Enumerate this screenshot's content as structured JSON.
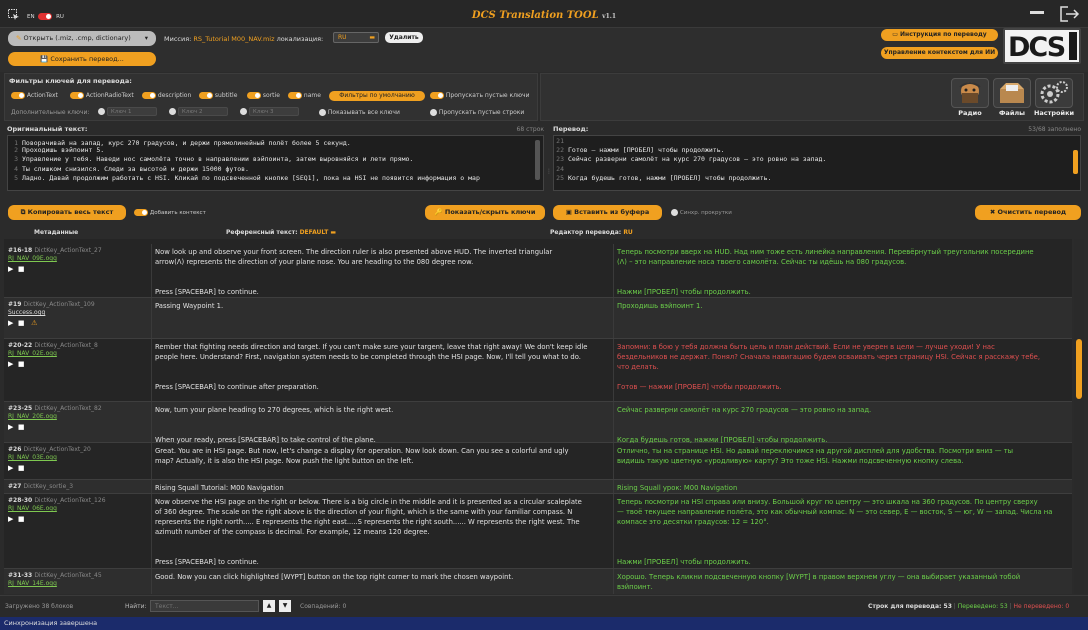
{
  "app": {
    "title": "DCS Translation TOOL",
    "version": "v1.1"
  },
  "lang": {
    "en": "EN",
    "ru": "RU"
  },
  "toolbar": {
    "open_label": "Открыть (.miz, .cmp, dictionary)",
    "save_label": "Сохранить перевод...",
    "mission_label": "Миссия:",
    "mission_value": "RS_Tutorial M00_NAV.miz",
    "locale_label": "локализация:",
    "locale_value": "RU",
    "delete_label": "Удалить",
    "instructions_label": "Инструкция по переводу",
    "context_label": "Управление контекстом для ИИ"
  },
  "filters": {
    "title": "Фильтры ключей для перевода:",
    "items": [
      "ActionText",
      "ActionRadioText",
      "description",
      "subtitle",
      "sortie",
      "name"
    ],
    "default_button": "Фильтры по умолчанию",
    "skip_empty": "Пропускать пустые ключи",
    "extra_label": "Дополнительные ключи:",
    "key_placeholders": [
      "Ключ 1",
      "Ключ 2",
      "Ключ 3"
    ],
    "show_all": "Показывать все ключи",
    "skip_empty_lines": "Пропускать пустые строки"
  },
  "side_buttons": [
    {
      "label": "Радио",
      "icon": "radio-icon"
    },
    {
      "label": "Файлы",
      "icon": "files-icon"
    },
    {
      "label": "Настройки",
      "icon": "gear-icon"
    }
  ],
  "original": {
    "label": "Оригинальный текст:",
    "count": "68 строк",
    "lines": [
      {
        "n": "1",
        "t": "Поворачивай на запад, курс 270 градусов, и держи прямолинейный полёт более 5 секунд."
      },
      {
        "n": "2",
        "t": "Проходишь вэйпоинт 5."
      },
      {
        "n": "3",
        "t": "Управление у тебя. Наведи нос самолёта точно в направлении вэйпоинта, затем выровняйся и лети прямо."
      },
      {
        "n": "4",
        "t": "Ты слишком снизился. Следи за высотой и держи 15000 футов."
      },
      {
        "n": "5",
        "t": "Ладно. Давай продолжим работать с HSI. Кликай по подсвеченной кнопке [SEQ1], пока на HSI не появится информация о мар"
      }
    ],
    "copy_all": "Копировать весь текст",
    "add_context": "Добавить контекст"
  },
  "translation": {
    "label": "Перевод:",
    "count": "53/68 заполнено",
    "lines": [
      {
        "n": "21",
        "t": ""
      },
      {
        "n": "22",
        "t": "Готов — нажми [ПРОБЕЛ] чтобы продолжить."
      },
      {
        "n": "23",
        "t": "Сейчас разверни самолёт на курс 270 градусов — это ровно на запад."
      },
      {
        "n": "24",
        "t": ""
      },
      {
        "n": "25",
        "t": "Когда будешь готов, нажми [ПРОБЕЛ] чтобы продолжить."
      }
    ],
    "paste": "Вставить из буфера",
    "sync_scroll": "Синхр. прокрутки",
    "clear": "Очистить перевод"
  },
  "mid": {
    "toggle_keys": "Показать/скрыть ключи",
    "meta_label": "Метаданные",
    "ref_label": "Референсный текст:",
    "ref_value": "DEFAULT",
    "editor_label": "Редактор перевода:",
    "editor_value": "RU"
  },
  "rows": [
    {
      "id": "#16-18",
      "key": "DictKey_ActionText_27",
      "file": "RJ_NAV_09E.ogg",
      "warn": false,
      "en": "Now look up and observe your front screen. The direction ruler is also presented above HUD. The inverted triangular\narrow(Λ) represents the direction of your plane nose. You are heading to the 080 degree now.\n\n\nPress [SPACEBAR] to continue.",
      "ru": "Теперь посмотри вверх на HUD. Над ним тоже есть линейка направления. Перевёрнутый треугольник посередине\n(Λ) – это направление носа твоего самолёта. Сейчас ты идёшь на 080 градусов.\n\n\nНажми [ПРОБЕЛ] чтобы продолжить.",
      "red": false
    },
    {
      "id": "#19",
      "key": "DictKey_ActionText_109",
      "file": "Success.ogg",
      "warn": true,
      "en": "Passing Waypoint 1.",
      "ru": "Проходишь вэйпоинт 1.",
      "red": false
    },
    {
      "id": "#20-22",
      "key": "DictKey_ActionText_8",
      "file": "RJ_NAV_02E.ogg",
      "warn": false,
      "en": "Rember that fighting needs direction and target. If you can't make sure your targent, leave that right away! We don't keep idle\npeople here. Understand? First, navigation system needs to be completed through the HSI page. Now, I'll tell you what to do.\n\n\nPress [SPACEBAR] to continue after preparation.",
      "ru": "Запомни: в бою у тебя должна быть цель и план действий. Если не уверен в цели — лучше уходи! У нас\nбездельников не держат. Понял? Сначала навигацию будем осваивать через страницу HSI. Сейчас я расскажу тебе,\nчто делать.\n\nГотов — нажми [ПРОБЕЛ] чтобы продолжить.",
      "red": true
    },
    {
      "id": "#23-25",
      "key": "DictKey_ActionText_82",
      "file": "RJ_NAV_20E.ogg",
      "warn": false,
      "en": "Now, turn your plane heading to 270 degrees, which is the right west.\n\n\nWhen your ready, press [SPACEBAR] to take control of the plane.",
      "ru": "Сейчас разверни самолёт на курс 270 градусов — это ровно на запад.\n\n\nКогда будешь готов, нажми [ПРОБЕЛ] чтобы продолжить.",
      "red": false
    },
    {
      "id": "#26",
      "key": "DictKey_ActionText_20",
      "file": "RJ_NAV_03E.ogg",
      "warn": false,
      "en": "Great. You are in HSI page. But now, let's change a display for operation. Now look down. Can you see a colorful and ugly\nmap? Actually, it is also the HSI page. Now push the light button on the left.",
      "ru": "Отлично, ты на странице HSI. Но давай переключимся на другой дисплей для удобства. Посмотри вниз — ты\nвидишь такую цветную «уродливую» карту? Это тоже HSI. Нажми подсвеченную кнопку слева.",
      "red": false
    },
    {
      "id": "#27",
      "key": "DictKey_sortie_3",
      "file": "",
      "warn": false,
      "en": "Rising Squall Tutorial: M00 Navigation",
      "ru": "Rising Squall урок: M00 Navigation",
      "red": false
    },
    {
      "id": "#28-30",
      "key": "DictKey_ActionText_126",
      "file": "RJ_NAV_06E.ogg",
      "warn": false,
      "en": "Now observe the HSI page on the right or below. There is a big circle in the middle and it is presented as a circular scaleplate\nof 360 degree. The scale on the right above is the direction of your flight, which is the same with your familiar compass. N\nrepresents the right north..... E represents the right east.....S represents the right south...... W represents the right west. The\nazimuth number of the compass is decimal. For example, 12 means 120 degree.\n\n\nPress [SPACEBAR] to continue.",
      "ru": "Теперь посмотри на HSI справа или внизу. Большой круг по центру — это шкала на 360 градусов. По центру сверху\n— твоё текущее направление полёта, это как обычный компас. N — это север, E — восток, S — юг, W — запад. Числа на\nкомпасе это десятки градусов: 12 = 120°.\n\n\n\nНажми [ПРОБЕЛ] чтобы продолжить.",
      "red": false
    },
    {
      "id": "#31-33",
      "key": "DictKey_ActionText_45",
      "file": "RJ_NAV_14E.ogg",
      "warn": false,
      "en": "Good. Now you can click highlighted [WYPT] button on the top right corner to mark the chosen waypoint.",
      "ru": "Хорошо. Теперь кликни подсвеченную кнопку [WYPT] в правом верхнем углу — она выбирает указанный тобой\nвэйпоинт.",
      "red": false
    }
  ],
  "footer": {
    "loaded": "Загружено 38 блоков",
    "find_label": "Найти:",
    "find_placeholder": "Текст...",
    "matches": "Совпадений: 0",
    "total": "Строк для перевода: 53",
    "translated": "Переведено: 53",
    "untranslated": "Не переведено: 0"
  },
  "status": "Синхронизация завершена",
  "colors": {
    "accent": "#f0a020",
    "translated": "#6cd04a",
    "missing": "#e05050",
    "statusbar": "#1b2b6b"
  }
}
